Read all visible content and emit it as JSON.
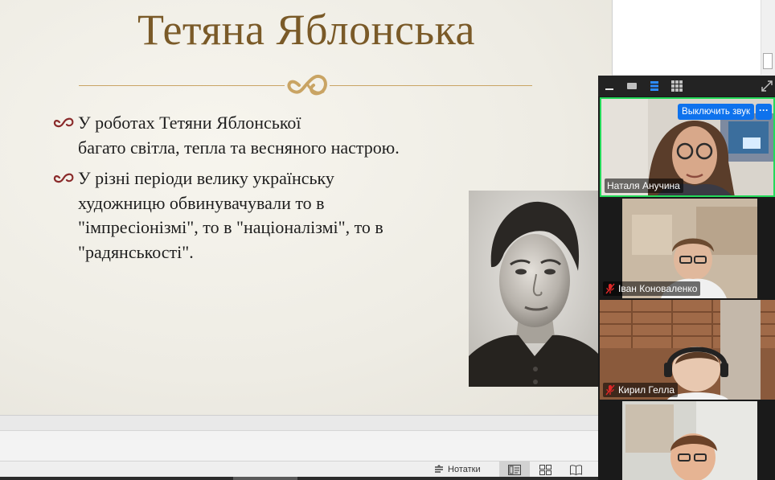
{
  "slide": {
    "title": "Тетяна Яблонська",
    "bullets": [
      {
        "text": "У роботах Тетяни Яблонської\nбагато світла, тепла та весняного настрою."
      },
      {
        "text": "У різні періоди велику українську\nхудожницю обвинувачували то в\n\"імпресіонізмі\", то в \"націоналізмі\", то в\n\"радянськості\"."
      }
    ],
    "title_color": "#7a5a28",
    "accent_color": "#8a2a2a"
  },
  "status_bar": {
    "notes_label": "Нотатки",
    "views": [
      "normal-view-icon",
      "slide-sorter-icon",
      "reading-view-icon"
    ]
  },
  "zoom": {
    "toolbar_icons": [
      "minimize-icon",
      "single-view-icon",
      "strip-view-icon",
      "gallery-view-icon",
      "expand-icon"
    ],
    "participants": [
      {
        "name": "Наталя Анучина",
        "muted": false,
        "active_speaker": true,
        "hover_button": "Выключить звук",
        "more": "···"
      },
      {
        "name": "Іван Коноваленко",
        "muted": true,
        "active_speaker": false
      },
      {
        "name": "Кирил Гелла",
        "muted": true,
        "active_speaker": false
      },
      {
        "name": "",
        "muted": false,
        "active_speaker": false
      }
    ],
    "speaker_color": "#23d959",
    "button_color": "#0e72ed"
  }
}
